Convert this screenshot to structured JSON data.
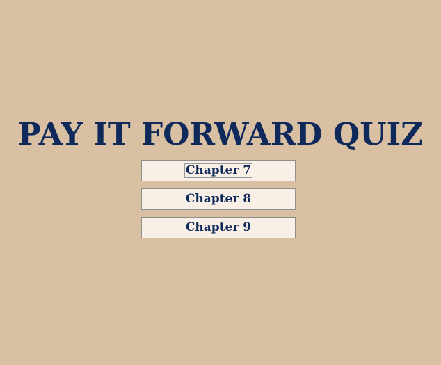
{
  "page": {
    "title": "PAY IT FORWARD QUIZ"
  },
  "menu": {
    "items": [
      {
        "label": "Chapter 7",
        "focused": true
      },
      {
        "label": "Chapter 8",
        "focused": false
      },
      {
        "label": "Chapter 9",
        "focused": false
      }
    ]
  },
  "colors": {
    "background": "#dac0a3",
    "title": "#0f2a5a",
    "button_bg": "#f8f0e6",
    "button_border": "#8e8e8e"
  }
}
